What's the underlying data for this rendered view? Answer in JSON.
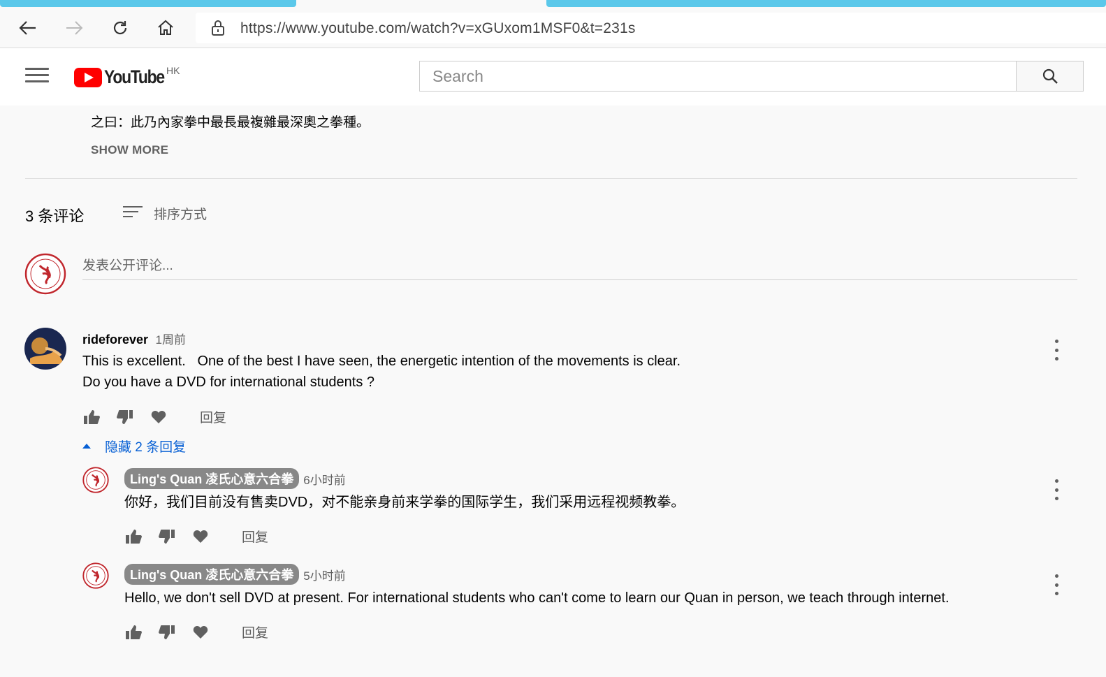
{
  "browser": {
    "url": "https://www.youtube.com/watch?v=xGUxom1MSF0&t=231s"
  },
  "youtube": {
    "logo_text": "YouTube",
    "region": "HK",
    "search_placeholder": "Search"
  },
  "description": {
    "visible_line": "之曰：此乃內家拳中最長最複雜最深奧之拳種。",
    "show_more": "SHOW MORE"
  },
  "comments": {
    "count_label": "3 条评论",
    "sort_label": "排序方式",
    "post_placeholder": "发表公开评论...",
    "hide_replies_label": "隐藏 2 条回复",
    "reply_label": "回复",
    "items": [
      {
        "author": "rideforever",
        "time": "1周前",
        "line1": "This is excellent.   One of the best I have seen, the energetic intention of the movements is clear.",
        "line2": "Do you have a DVD for international students ?"
      }
    ],
    "replies": [
      {
        "author": "Ling's Quan 凌氏心意六合拳",
        "time": "6小时前",
        "text": "你好，我们目前没有售卖DVD，对不能亲身前来学拳的国际学生，我们采用远程视频教拳。"
      },
      {
        "author": "Ling's Quan 凌氏心意六合拳",
        "time": "5小时前",
        "text": "Hello, we don't sell DVD at present. For international students who can't come to learn our Quan in person, we teach through internet."
      }
    ]
  }
}
